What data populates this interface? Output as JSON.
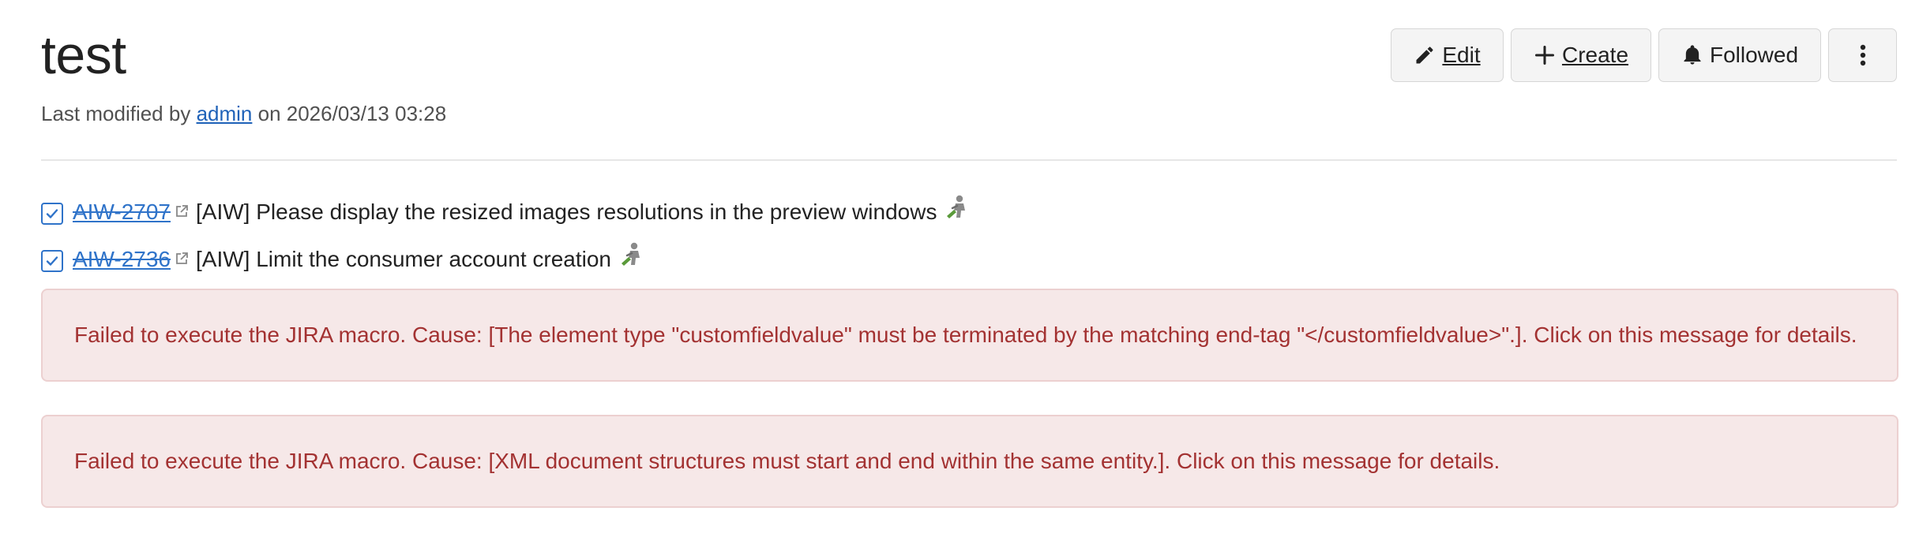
{
  "page": {
    "title": "test",
    "meta": {
      "prefix": "Last modified by ",
      "author": "admin",
      "suffix": " on 2026/03/13 03:28"
    }
  },
  "toolbar": {
    "edit_label": "Edit",
    "create_label": "Create",
    "followed_label": "Followed",
    "more_icon": "kebab-vertical-icon"
  },
  "jira_issues": [
    {
      "key": "AIW-2707",
      "summary": "[AIW] Please display the resized images resolutions in the preview windows",
      "status": "done",
      "icons": [
        "checkbox-checked-icon",
        "external-link-icon",
        "worker-icon"
      ]
    },
    {
      "key": "AIW-2736",
      "summary": "[AIW] Limit the consumer account creation",
      "status": "done",
      "icons": [
        "checkbox-checked-icon",
        "external-link-icon",
        "worker-icon"
      ]
    }
  ],
  "errors": [
    {
      "message": "Failed to execute the JIRA macro. Cause: [The element type \"customfieldvalue\" must be terminated by the matching end-tag \"</customfieldvalue>\".]. Click on this message for details."
    },
    {
      "message": "Failed to execute the JIRA macro. Cause: [XML document structures must start and end within the same entity.]. Click on this message for details."
    }
  ],
  "colors": {
    "link": "#1f62b8",
    "issue_key": "#2f73c9",
    "error_text": "#a33232",
    "error_bg": "#f6e8e8",
    "error_border": "#ecd0d0",
    "button_bg": "#f4f4f4"
  }
}
